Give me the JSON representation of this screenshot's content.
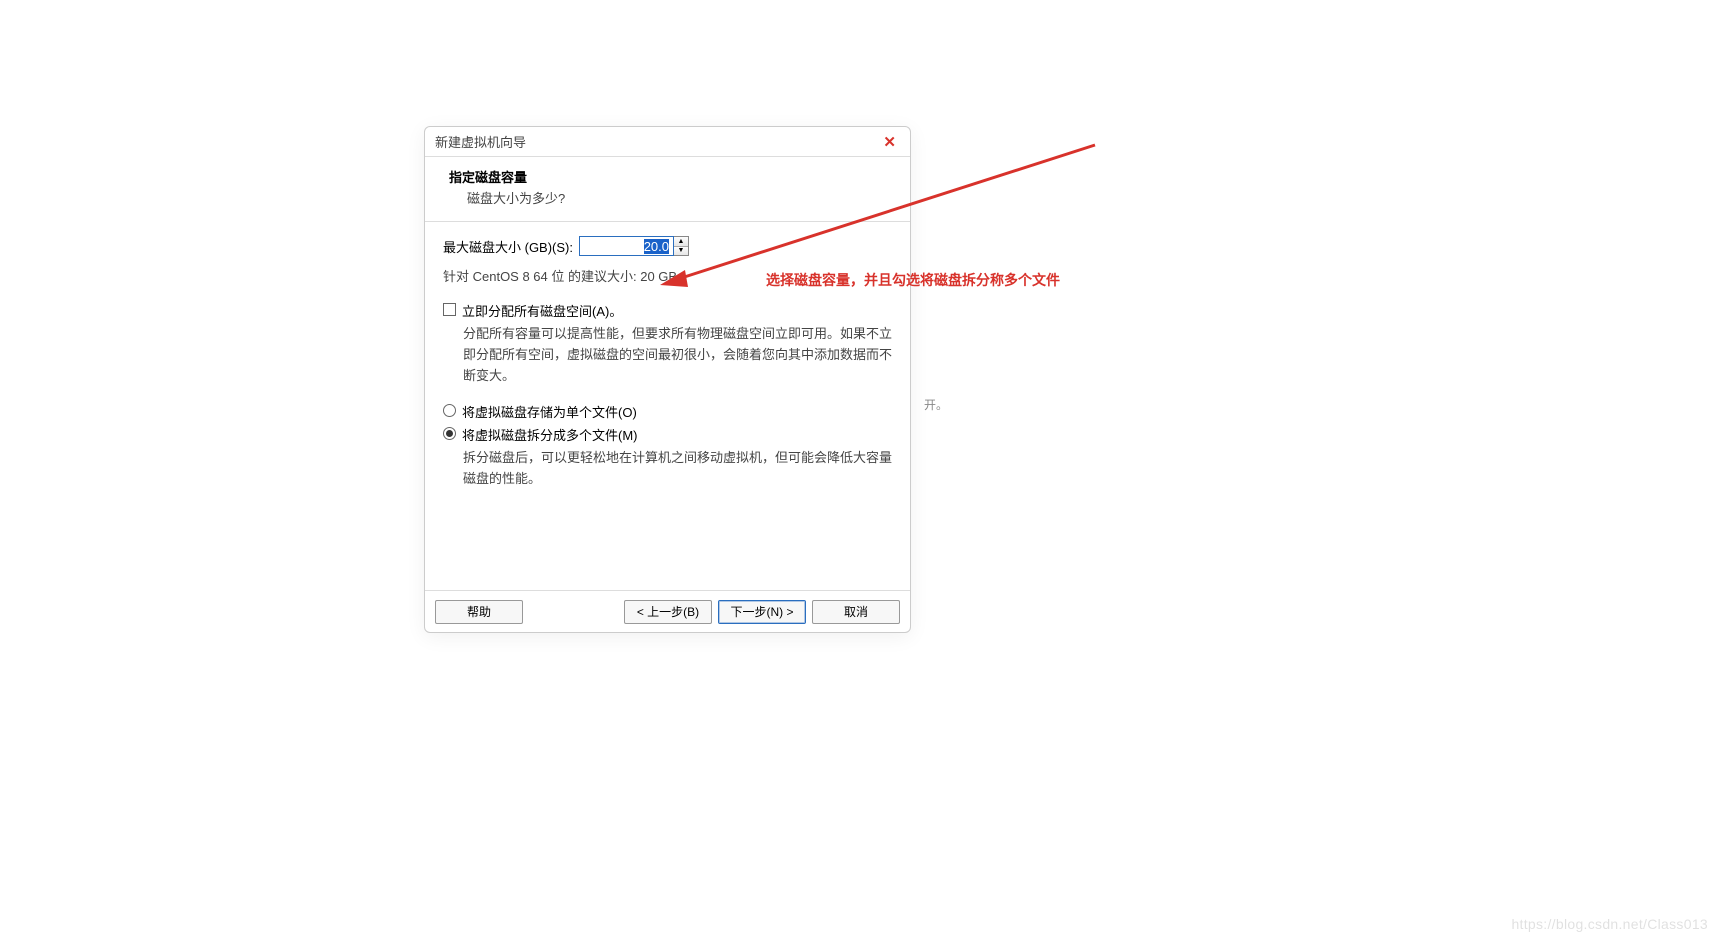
{
  "dialog": {
    "window_title": "新建虚拟机向导",
    "heading": "指定磁盘容量",
    "subheading": "磁盘大小为多少?",
    "max_size_label": "最大磁盘大小 (GB)(S):",
    "max_size_value": "20.0",
    "recommended": "针对 CentOS 8 64 位 的建议大小: 20 GB",
    "allocate_now_label": "立即分配所有磁盘空间(A)。",
    "allocate_now_desc": "分配所有容量可以提高性能，但要求所有物理磁盘空间立即可用。如果不立即分配所有空间，虚拟磁盘的空间最初很小，会随着您向其中添加数据而不断变大。",
    "radio_single_label": "将虚拟磁盘存储为单个文件(O)",
    "radio_split_label": "将虚拟磁盘拆分成多个文件(M)",
    "split_desc": "拆分磁盘后，可以更轻松地在计算机之间移动虚拟机，但可能会降低大容量磁盘的性能。",
    "selected_option": "split",
    "buttons": {
      "help": "帮助",
      "back": "< 上一步(B)",
      "next": "下一步(N) >",
      "cancel": "取消"
    }
  },
  "annotation": {
    "text": "选择磁盘容量，并且勾选将磁盘拆分称多个文件",
    "color": "#d8322b"
  },
  "stray_text": "开。",
  "watermark": "https://blog.csdn.net/Class013"
}
